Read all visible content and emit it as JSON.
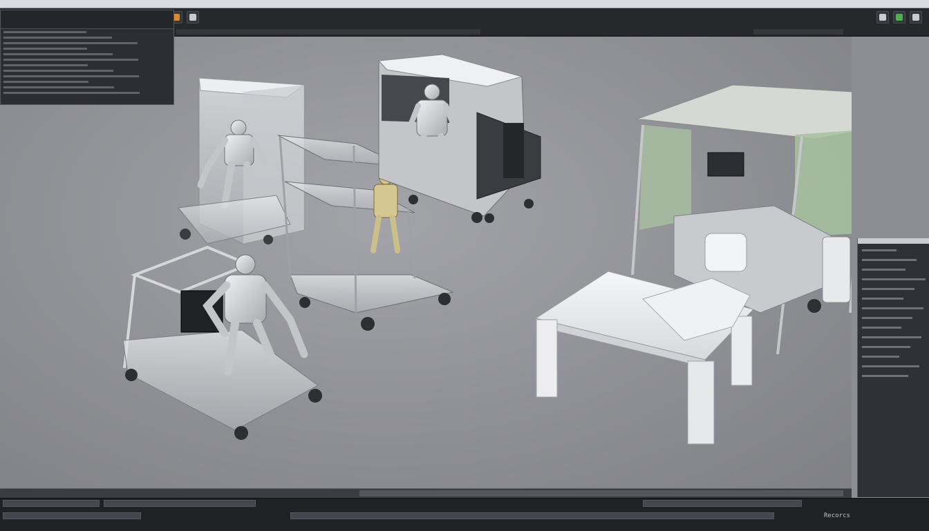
{
  "app": {
    "colors": {
      "toolbar_bg": "#26282c",
      "viewport_bg": "#8f9095",
      "panel_bg": "#2f3136",
      "accent_green": "#4caf50",
      "accent_yellow": "#e1b12c",
      "accent_red": "#d9534f",
      "accent_blue": "#4a90d9"
    }
  },
  "toolbar": {
    "buttons": [
      {
        "icon": "file-icon",
        "color": "#c8ccd2"
      },
      {
        "icon": "folder-icon",
        "color": "#e1b12c"
      },
      {
        "icon": "save-icon",
        "color": "#4a90d9"
      },
      {
        "icon": "undo-icon",
        "color": "#c8ccd2"
      },
      {
        "icon": "redo-icon",
        "color": "#c8ccd2"
      },
      {
        "icon": "render-icon",
        "color": "#e1b12c"
      },
      {
        "icon": "record-icon",
        "color": "#d9534f"
      },
      {
        "icon": "camera-icon",
        "color": "#4caf50"
      },
      {
        "icon": "light-icon",
        "color": "#f0d060"
      },
      {
        "icon": "mesh-icon",
        "color": "#4a90d9"
      },
      {
        "icon": "material-icon",
        "color": "#d98a2c"
      },
      {
        "icon": "settings-icon",
        "color": "#c8ccd2"
      }
    ],
    "right_icons": [
      {
        "icon": "layout-icon",
        "color": "#c8ccd2"
      },
      {
        "icon": "user-icon",
        "color": "#4caf50"
      },
      {
        "icon": "help-icon",
        "color": "#c8ccd2"
      }
    ]
  },
  "left_console": {
    "rows": [
      "",
      "",
      "",
      "",
      "",
      "",
      "",
      "",
      "",
      "",
      "",
      ""
    ]
  },
  "right_panel": {
    "rows": [
      "",
      "",
      "",
      "",
      "",
      "",
      "",
      "",
      "",
      "",
      "",
      "",
      "",
      ""
    ]
  },
  "bottom_bar": {
    "right_label": "Recorcs"
  }
}
